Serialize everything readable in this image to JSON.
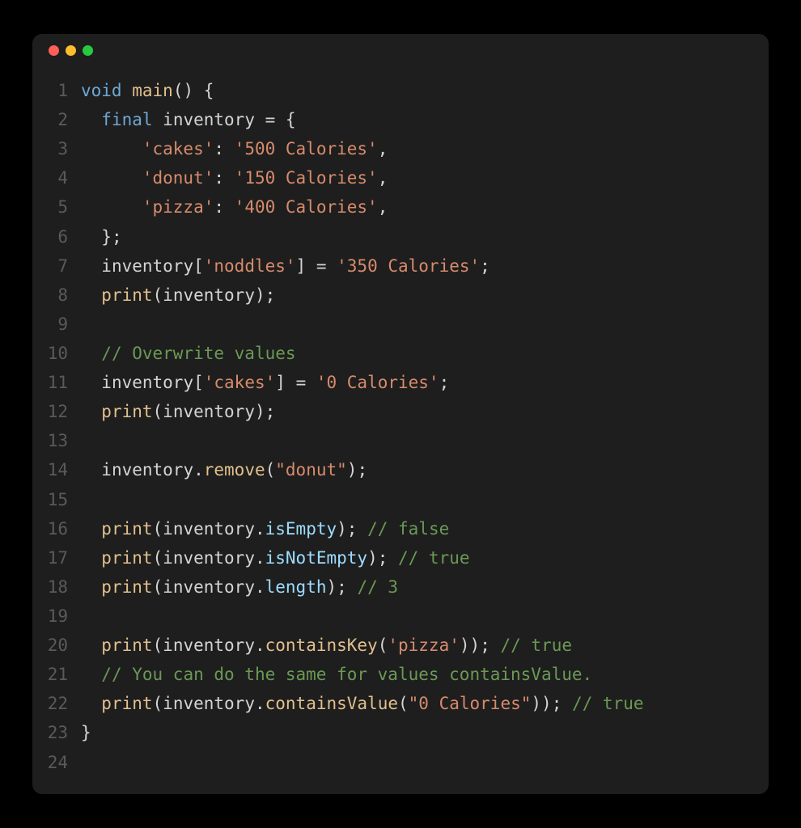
{
  "colors": {
    "bg": "#1e1e1e",
    "red": "#ff5f56",
    "yellow": "#ffbd2e",
    "green": "#27c93f"
  },
  "lines": {
    "l1": "1",
    "l2": "2",
    "l3": "3",
    "l4": "4",
    "l5": "5",
    "l6": "6",
    "l7": "7",
    "l8": "8",
    "l9": "9",
    "l10": "10",
    "l11": "11",
    "l12": "12",
    "l13": "13",
    "l14": "14",
    "l15": "15",
    "l16": "16",
    "l17": "17",
    "l18": "18",
    "l19": "19",
    "l20": "20",
    "l21": "21",
    "l22": "22",
    "l23": "23",
    "l24": "24"
  },
  "code": {
    "void": "void",
    "main": "main",
    "paren_open": "(",
    "paren_close": ")",
    "brace_open": "{",
    "brace_close": "}",
    "final": "final",
    "inventory": "inventory",
    "eq": " = ",
    "sp2": "  ",
    "sp4": "    ",
    "sp6": "      ",
    "s_cakes": "'cakes'",
    "colon": ": ",
    "s_500cal": "'500 Calories'",
    "comma": ",",
    "s_donut": "'donut'",
    "s_150cal": "'150 Calories'",
    "s_pizza": "'pizza'",
    "s_400cal": "'400 Calories'",
    "semi": ";",
    "lbrack": "[",
    "rbrack": "]",
    "s_noddles": "'noddles'",
    "s_350cal": "'350 Calories'",
    "print": "print",
    "c_overwrite": "// Overwrite values",
    "s_0cal": "'0 Calories'",
    "dot": ".",
    "remove": "remove",
    "s_donut_dq": "\"donut\"",
    "isEmpty": "isEmpty",
    "c_false": "// false",
    "isNotEmpty": "isNotEmpty",
    "c_true": "// true",
    "length": "length",
    "c_3": "// 3",
    "containsKey": "containsKey",
    "c_containsvalue": "// You can do the same for values containsValue.",
    "containsValue": "containsValue",
    "s_0cal_dq": "\"0 Calories\""
  }
}
